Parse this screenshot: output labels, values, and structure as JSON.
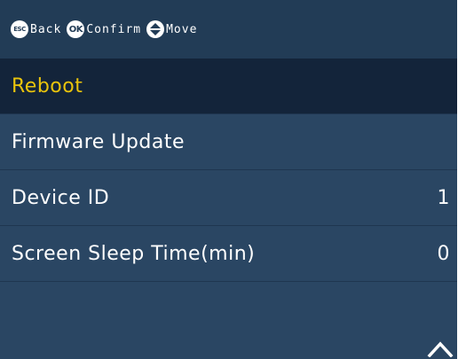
{
  "topbar": {
    "hints": [
      {
        "badge": "ESC",
        "label": "Back"
      },
      {
        "badge": "OK",
        "label": "Confirm"
      },
      {
        "badge": "",
        "label": "Move"
      }
    ]
  },
  "menu": {
    "items": [
      {
        "label": "Reboot",
        "value": "",
        "selected": true
      },
      {
        "label": "Firmware Update",
        "value": ""
      },
      {
        "label": "Device ID",
        "value": "1"
      },
      {
        "label": "Screen Sleep Time(min)",
        "value": "0"
      }
    ]
  },
  "colors": {
    "background": "#2a4663",
    "topbar": "#223c56",
    "selected_row": "#13243a",
    "selected_text": "#e9c40c",
    "text": "#ffffff"
  },
  "icons": {
    "esc": "esc-badge-icon",
    "ok": "ok-badge-icon",
    "move": "up-down-arrows-icon",
    "scroll": "chevron-up-icon"
  }
}
